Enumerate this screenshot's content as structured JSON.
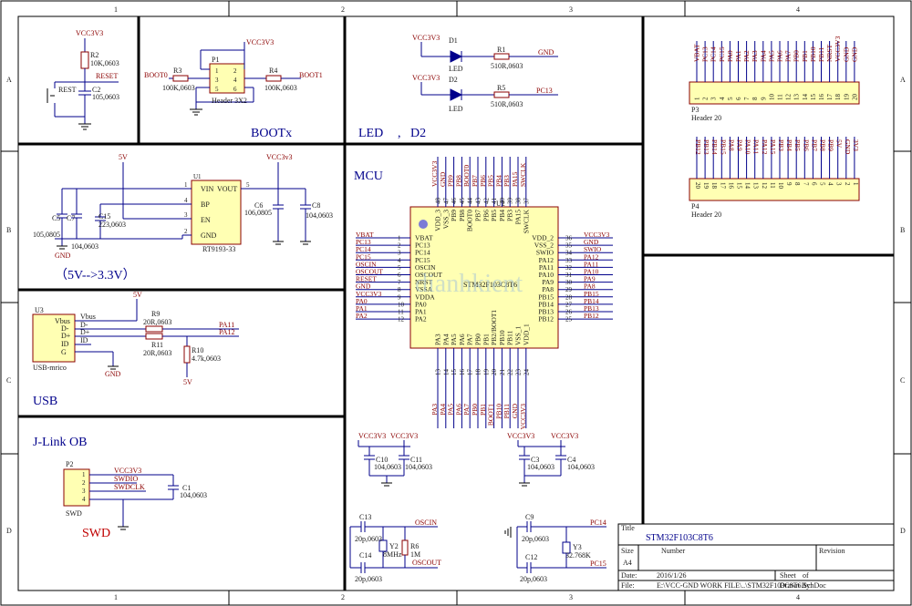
{
  "frame": {
    "cols": [
      "1",
      "2",
      "3",
      "4"
    ],
    "rows": [
      "A",
      "B",
      "C",
      "D"
    ]
  },
  "sections": {
    "bootx": "BOOTx",
    "led": "LED",
    "d2": "D2",
    "ldo": "（5V-->3.3V）",
    "mcu": "MCU",
    "usb": "USB",
    "jlink": "J-Link OB",
    "swd": "SWD"
  },
  "watermark": "dianhkient",
  "reset": {
    "vcc": "VCC3V3",
    "r2": "R2",
    "r2v": "10K,0603",
    "reset_net": "RESET",
    "sw": "REST",
    "c2": "C2",
    "c2v": "105,0603"
  },
  "boot": {
    "vcc": "VCC3V3",
    "p1": "P1",
    "r3": "R3",
    "r3v": "100K,0603",
    "r4": "R4",
    "r4v": "100K,0603",
    "boot0": "BOOT0",
    "boot1": "BOOT1",
    "hdr": "Header 3X2",
    "p1n": [
      "1",
      "2",
      "3",
      "4",
      "5",
      "6"
    ]
  },
  "leds": {
    "vcc1": "VCC3V3",
    "vcc2": "VCC3V3",
    "d1": "D1",
    "d2": "D2",
    "led1": "LED",
    "led2": "LED",
    "r1": "R1",
    "r1v": "510R,0603",
    "r5": "R5",
    "r5v": "510R,0603",
    "gnd": "GND",
    "pc13": "PC13"
  },
  "ldo": {
    "v5": "5V",
    "vcc": "VCC3v3",
    "u1": "U1",
    "part": "RT9193-33",
    "vin": "VIN",
    "vout": "VOUT",
    "bp": "BP",
    "en": "EN",
    "gnd": "GND",
    "p1": "1",
    "p2": "2",
    "p3": "3",
    "p4": "4",
    "p5": "5",
    "c5": "C5",
    "c5v": "105,0805",
    "c7": "C7",
    "c7v": "104,0603",
    "c15": "C15",
    "c15v": "223,0603",
    "c6": "C6",
    "c6v": "106,0805",
    "c8": "C8",
    "c8v": "104,0603",
    "gndl": "GND"
  },
  "usb": {
    "u3": "U3",
    "v5": "5V",
    "vbus": "Vbus",
    "dm": "D-",
    "dp": "D+",
    "id": "ID",
    "g": "G",
    "vbus_n": "Vbus",
    "dm_n": "D-",
    "dp_n": "D+",
    "id_n": "ID",
    "r9": "R9",
    "r9v": "20R,0603",
    "r11": "R11",
    "r11v": "20R,0603",
    "r10": "R10",
    "r10v": "4.7k,0603",
    "pa11": "PA11",
    "pa12": "PA12",
    "gnd": "GND",
    "v5b": "5V",
    "part": "USB-mrico"
  },
  "swd": {
    "p2": "P2",
    "vcc": "VCC3V3",
    "swdio": "SWDIO",
    "swdclk": "SWDCLK",
    "c1": "C1",
    "c1v": "104,0603",
    "part": "SWD",
    "pins": [
      "1",
      "2",
      "3",
      "4"
    ]
  },
  "mcu": {
    "u2": "U2",
    "part": "STM32F103C8T6",
    "left": [
      [
        "1",
        "VBAT",
        "VBAT"
      ],
      [
        "2",
        "PC13",
        "PC13"
      ],
      [
        "3",
        "PC14",
        "PC14"
      ],
      [
        "4",
        "PC15",
        "PC15"
      ],
      [
        "5",
        "OSCIN",
        "OSCIN"
      ],
      [
        "6",
        "OSCOUT",
        "OSCOUT"
      ],
      [
        "7",
        "NRST",
        "RESET"
      ],
      [
        "8",
        "VSSA",
        "GND"
      ],
      [
        "9",
        "VDDA",
        "VCC3V3"
      ],
      [
        "10",
        "PA0",
        "PA0"
      ],
      [
        "11",
        "PA1",
        "PA1"
      ],
      [
        "12",
        "PA2",
        "PA2"
      ]
    ],
    "right": [
      [
        "36",
        "VDD_2",
        "VCC3V3"
      ],
      [
        "35",
        "VSS_2",
        "GND"
      ],
      [
        "34",
        "SWIO",
        "SWIO"
      ],
      [
        "33",
        "PA12",
        "PA12"
      ],
      [
        "32",
        "PA11",
        "PA11"
      ],
      [
        "31",
        "PA10",
        "PA10"
      ],
      [
        "30",
        "PA9",
        "PA9"
      ],
      [
        "29",
        "PA8",
        "PA8"
      ],
      [
        "28",
        "PB15",
        "PB15"
      ],
      [
        "27",
        "PB14",
        "PB14"
      ],
      [
        "26",
        "PB13",
        "PB13"
      ],
      [
        "25",
        "PB12",
        "PB12"
      ]
    ],
    "top": [
      [
        "48",
        "VDD_3",
        "VCC3V3"
      ],
      [
        "47",
        "VSS_3",
        "GND"
      ],
      [
        "46",
        "PB9",
        "PB9"
      ],
      [
        "45",
        "PB8",
        "PB8"
      ],
      [
        "44",
        "BOOT0",
        "BOOT0"
      ],
      [
        "43",
        "PB7",
        "PB7"
      ],
      [
        "42",
        "PB6",
        "PB6"
      ],
      [
        "41",
        "PB5",
        "PB5"
      ],
      [
        "40",
        "PB4",
        "PB4"
      ],
      [
        "39",
        "PB3",
        "PB3"
      ],
      [
        "38",
        "PA15",
        "PA15"
      ],
      [
        "37",
        "SWCLK",
        "SWCLK"
      ]
    ],
    "bottom": [
      [
        "13",
        "PA3",
        "PA3"
      ],
      [
        "14",
        "PA4",
        "PA4"
      ],
      [
        "15",
        "PA5",
        "PA5"
      ],
      [
        "16",
        "PA6",
        "PA6"
      ],
      [
        "17",
        "PA7",
        "PA7"
      ],
      [
        "18",
        "PB0",
        "PB0"
      ],
      [
        "19",
        "PB1",
        "PB1"
      ],
      [
        "20",
        "PB2/BOOT1",
        "BOOT1"
      ],
      [
        "21",
        "PB10",
        "PB10"
      ],
      [
        "22",
        "PB11",
        "PB11"
      ],
      [
        "23",
        "VSS_1",
        "GND"
      ],
      [
        "24",
        "VDD_1",
        "VCC3V3"
      ]
    ]
  },
  "decoup": {
    "vcc1": "VCC3V3",
    "vcc2": "VCC3V3",
    "vcc3": "VCC3V3",
    "vcc4": "VCC3V3",
    "c10": "C10",
    "c10v": "104,0603",
    "c11": "C11",
    "c11v": "104,0603",
    "c3": "C3",
    "c3v": "104,0603",
    "c4": "C4",
    "c4v": "104,0603"
  },
  "osc": {
    "c13": "C13",
    "c13v": "20p,0603",
    "c14": "C14",
    "c14v": "20p,0603",
    "y2": "Y2",
    "y2v": "8MHz",
    "r6": "R6",
    "r6v": "1M",
    "oscin": "OSCIN",
    "oscout": "OSCOUT",
    "c9": "C9",
    "c9v": "20p,0603",
    "c12": "C12",
    "c12v": "20p,0603",
    "y3": "Y3",
    "y3v": "32.768K",
    "pc14": "PC14",
    "pc15": "PC15"
  },
  "p3": {
    "name": "P3",
    "part": "Header 20",
    "nets": [
      "VBAT",
      "PC13",
      "PC14",
      "PC15",
      "PA0",
      "PA1",
      "PA2",
      "PA3",
      "PA4",
      "PA5",
      "PA6",
      "PA7",
      "PB0",
      "PB1",
      "PB10",
      "PB11",
      "NRST",
      "VCC3V3",
      "GND",
      "GND"
    ],
    "pins": [
      "1",
      "2",
      "3",
      "4",
      "5",
      "6",
      "7",
      "8",
      "9",
      "10",
      "11",
      "12",
      "13",
      "14",
      "15",
      "16",
      "17",
      "18",
      "19",
      "20"
    ]
  },
  "p4": {
    "name": "P4",
    "part": "Header 20",
    "nets": [
      "PB12",
      "PB13",
      "PB14",
      "PB15",
      "PA8",
      "PA9",
      "PA10",
      "PA11",
      "PA12",
      "PA15",
      "PB3",
      "PB4",
      "PB5",
      "PB6",
      "PB7",
      "PB8",
      "PB9",
      "5V",
      "GND",
      "3V3"
    ],
    "pins": [
      "20",
      "19",
      "18",
      "17",
      "16",
      "15",
      "14",
      "13",
      "12",
      "11",
      "10",
      "9",
      "8",
      "7",
      "6",
      "5",
      "4",
      "3",
      "2",
      "1"
    ]
  },
  "titleblock": {
    "title_lbl": "Title",
    "title": "STM32F103C8T6",
    "size_lbl": "Size",
    "size": "A4",
    "number_lbl": "Number",
    "rev_lbl": "Revision",
    "date_lbl": "Date:",
    "date": "2016/1/26",
    "sheet_lbl": "Sheet",
    "of_lbl": "of",
    "file_lbl": "File:",
    "file": "E:\\VCC-GND WORK FILE\\..\\STM32F103C8T6.SchDoc",
    "drawn_lbl": "Drawn By:"
  },
  "colors": {
    "wire": "#00008b",
    "ink": "#8b0000",
    "border": "#000000",
    "body": "#ffffb3"
  }
}
